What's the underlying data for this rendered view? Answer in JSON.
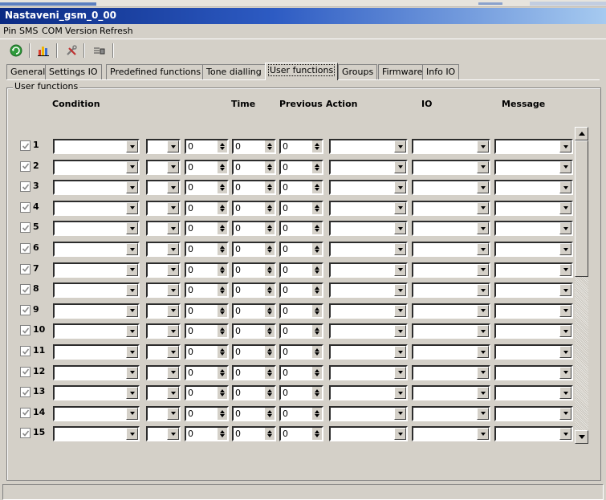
{
  "window": {
    "title": "Nastaveni_gsm_0_00"
  },
  "menu": [
    "Pin",
    "SMS",
    "COM",
    "Version",
    "Refresh"
  ],
  "toolbar": {
    "buttons": [
      "connect-icon",
      "chart-icon",
      "tools-icon",
      "print-icon"
    ]
  },
  "tabs": [
    "General",
    "Settings IO",
    "Predefined functions",
    "Tone dialling",
    "User functions",
    "Groups",
    "Firmware",
    "Info IO"
  ],
  "active_tab": "User functions",
  "group": {
    "title": "User functions"
  },
  "columns": {
    "condition": "Condition",
    "time": "Time",
    "previous": "Previous",
    "action": "Action",
    "io": "IO",
    "message": "Message"
  },
  "rows": [
    {
      "num": "1",
      "checked": true,
      "v1": "0",
      "v2": "0",
      "v3": "0"
    },
    {
      "num": "2",
      "checked": true,
      "v1": "0",
      "v2": "0",
      "v3": "0"
    },
    {
      "num": "3",
      "checked": true,
      "v1": "0",
      "v2": "0",
      "v3": "0"
    },
    {
      "num": "4",
      "checked": true,
      "v1": "0",
      "v2": "0",
      "v3": "0"
    },
    {
      "num": "5",
      "checked": true,
      "v1": "0",
      "v2": "0",
      "v3": "0"
    },
    {
      "num": "6",
      "checked": true,
      "v1": "0",
      "v2": "0",
      "v3": "0"
    },
    {
      "num": "7",
      "checked": true,
      "v1": "0",
      "v2": "0",
      "v3": "0"
    },
    {
      "num": "8",
      "checked": true,
      "v1": "0",
      "v2": "0",
      "v3": "0"
    },
    {
      "num": "9",
      "checked": true,
      "v1": "0",
      "v2": "0",
      "v3": "0"
    },
    {
      "num": "10",
      "checked": true,
      "v1": "0",
      "v2": "0",
      "v3": "0"
    },
    {
      "num": "11",
      "checked": true,
      "v1": "0",
      "v2": "0",
      "v3": "0"
    },
    {
      "num": "12",
      "checked": true,
      "v1": "0",
      "v2": "0",
      "v3": "0"
    },
    {
      "num": "13",
      "checked": true,
      "v1": "0",
      "v2": "0",
      "v3": "0"
    },
    {
      "num": "14",
      "checked": true,
      "v1": "0",
      "v2": "0",
      "v3": "0"
    },
    {
      "num": "15",
      "checked": true,
      "v1": "0",
      "v2": "0",
      "v3": "0"
    }
  ],
  "colors": {
    "title_start": "#0b2a83",
    "title_end": "#a6caf0",
    "face": "#d4d0c8"
  }
}
